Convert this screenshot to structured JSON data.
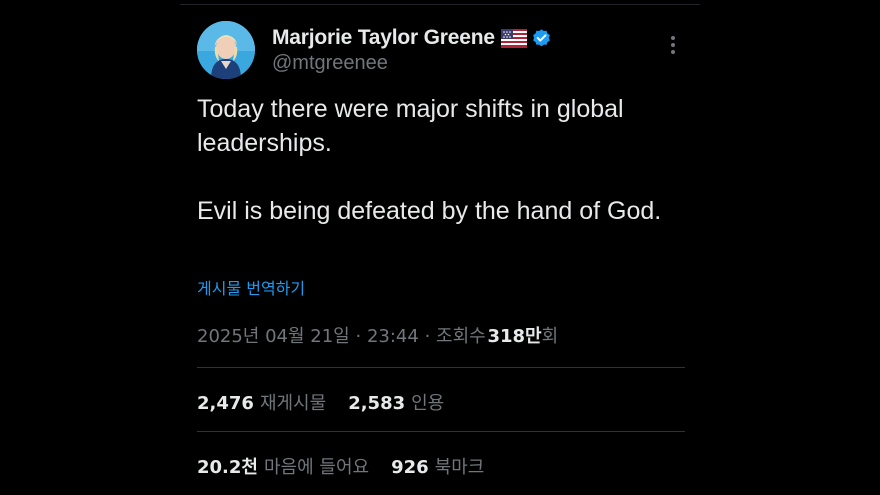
{
  "author": {
    "display_name": "Marjorie Taylor Greene",
    "handle": "@mtgreenee",
    "flag_icon": "us-flag-icon",
    "verified_icon": "verified-badge-icon",
    "verified_color": "#1d9bf0"
  },
  "tweet": {
    "paragraphs": [
      "Today there were major shifts in global leaderships.",
      "Evil is being defeated by the hand of God."
    ],
    "translate_label": "게시물 번역하기",
    "date": "2025년 04월 21일",
    "separator": "·",
    "time": "23:44",
    "views_label_prefix": "조회수",
    "views_value": "318만",
    "views_label_suffix": "회"
  },
  "stats": {
    "reposts": {
      "count": "2,476",
      "label": "재게시물"
    },
    "quotes": {
      "count": "2,583",
      "label": "인용"
    },
    "likes": {
      "count": "20.2천",
      "label": "마음에 들어요"
    },
    "bookmarks": {
      "count": "926",
      "label": "북마크"
    }
  },
  "colors": {
    "background": "#000000",
    "text_primary": "#e7e9ea",
    "text_secondary": "#71767b",
    "link": "#1d9bf0",
    "divider": "#2f3336"
  },
  "icons": {
    "more": "more-options-icon"
  }
}
